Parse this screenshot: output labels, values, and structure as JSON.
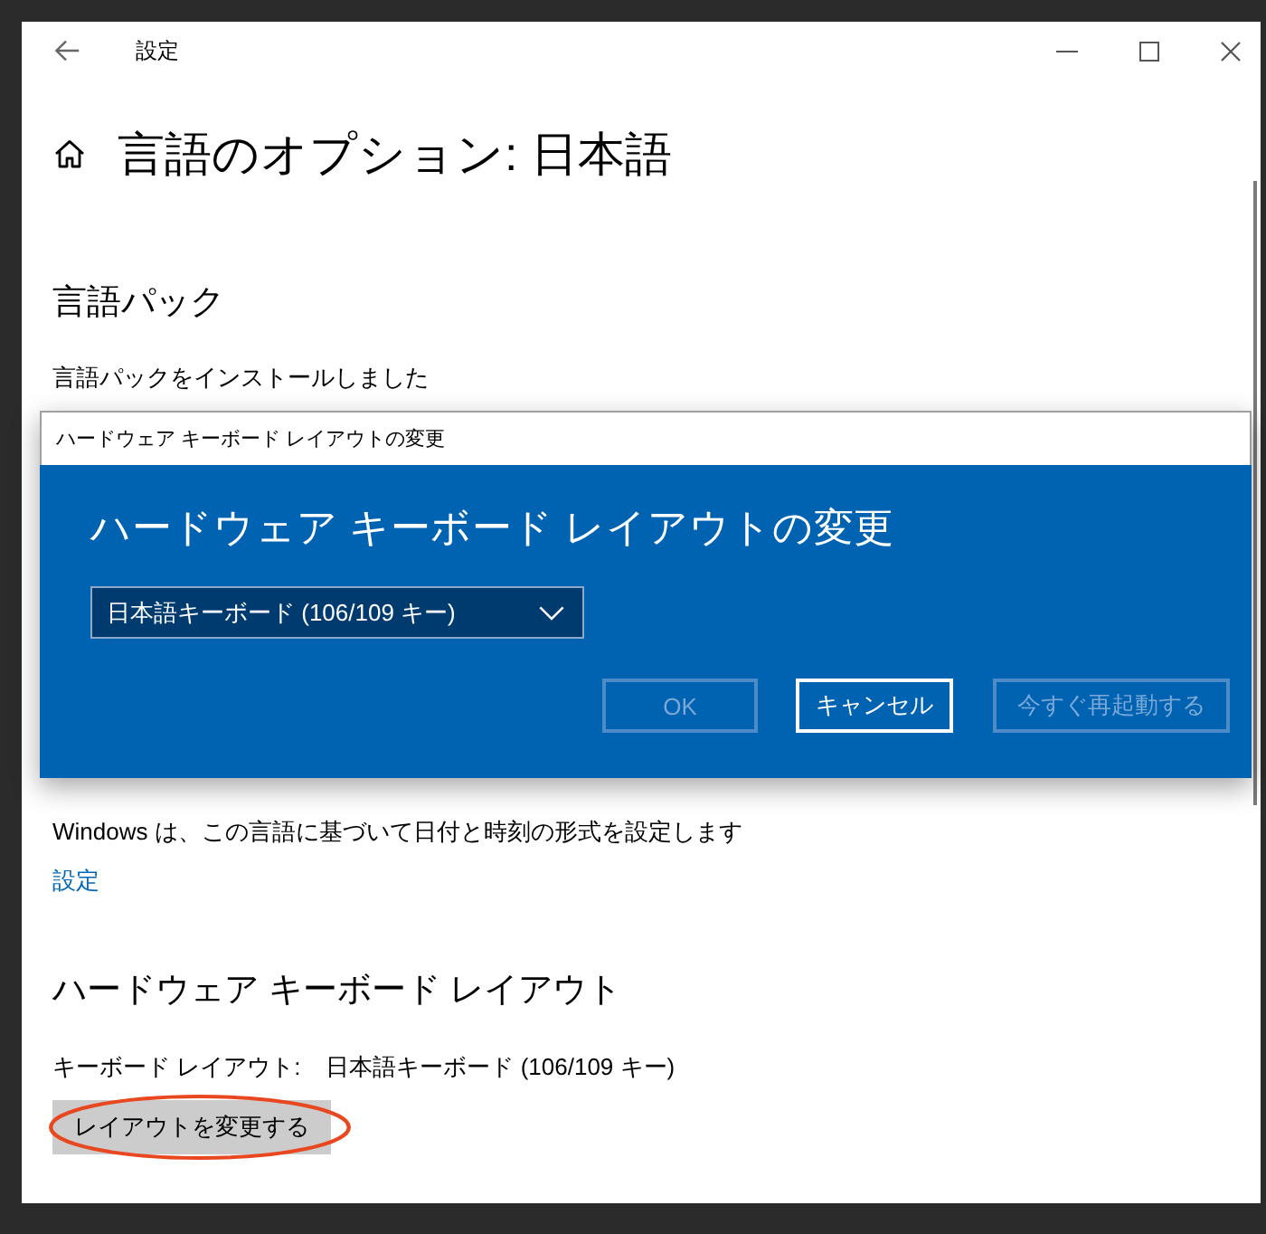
{
  "window": {
    "title": "設定"
  },
  "page": {
    "title": "言語のオプション: 日本語"
  },
  "language_pack": {
    "heading": "言語パック",
    "status": "言語パックをインストールしました"
  },
  "dialog": {
    "window_title": "ハードウェア キーボード レイアウトの変更",
    "title": "ハードウェア キーボード レイアウトの変更",
    "layout_dropdown": {
      "value": "日本語キーボード (106/109 キー)"
    },
    "buttons": [
      {
        "label": "OK",
        "disabled": true
      },
      {
        "label": "キャンセル",
        "disabled": false
      },
      {
        "label": "今すぐ再起動する",
        "disabled": true
      }
    ]
  },
  "regional_format": {
    "description": "Windows は、この言語に基づいて日付と時刻の形式を設定します",
    "link": "設定"
  },
  "hardware_keyboard": {
    "heading": "ハードウェア キーボード レイアウト",
    "label": "キーボード レイアウト:",
    "value": "日本語キーボード (106/109 キー)",
    "button": {
      "label": "レイアウトを変更する",
      "circled": true
    }
  }
}
